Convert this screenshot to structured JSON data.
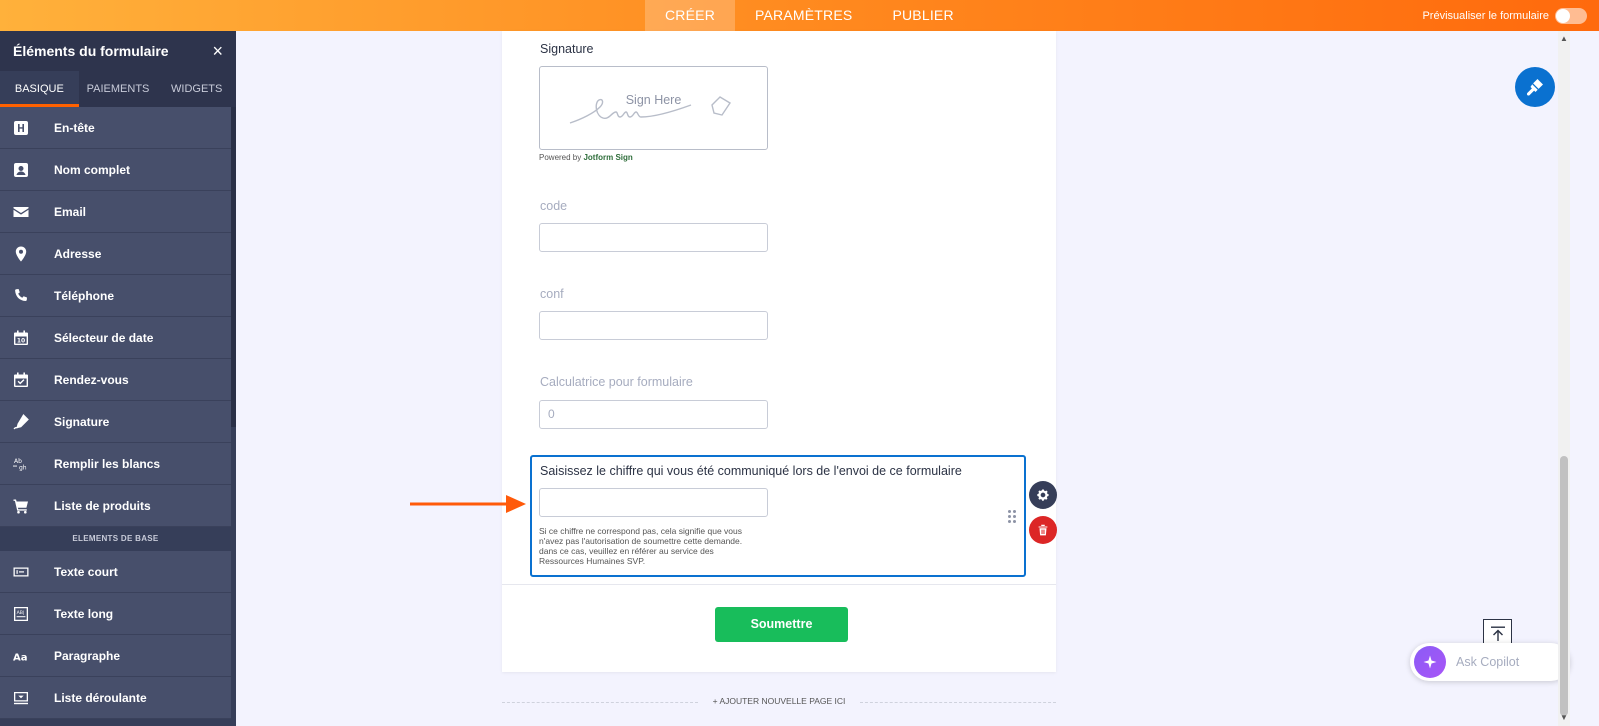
{
  "topbar": {
    "tabs": [
      {
        "label": "CRÉER",
        "active": true
      },
      {
        "label": "PARAMÈTRES",
        "active": false
      },
      {
        "label": "PUBLIER",
        "active": false
      }
    ],
    "preview_label": "Prévisualiser le formulaire"
  },
  "sidebar": {
    "title": "Éléments du formulaire",
    "close": "×",
    "tabs": [
      "BASIQUE",
      "PAIEMENTS",
      "WIDGETS"
    ],
    "items": [
      {
        "label": "En-tête",
        "icon": "heading-icon"
      },
      {
        "label": "Nom complet",
        "icon": "user-card-icon"
      },
      {
        "label": "Email",
        "icon": "envelope-icon"
      },
      {
        "label": "Adresse",
        "icon": "map-pin-icon"
      },
      {
        "label": "Téléphone",
        "icon": "phone-icon"
      },
      {
        "label": "Sélecteur de date",
        "icon": "calendar-icon"
      },
      {
        "label": "Rendez-vous",
        "icon": "calendar-check-icon"
      },
      {
        "label": "Signature",
        "icon": "pen-icon"
      },
      {
        "label": "Remplir les blancs",
        "icon": "fill-blanks-icon"
      },
      {
        "label": "Liste de produits",
        "icon": "cart-icon"
      }
    ],
    "section_label": "ELEMENTS DE BASE",
    "base_items": [
      {
        "label": "Texte court",
        "icon": "short-text-icon"
      },
      {
        "label": "Texte long",
        "icon": "long-text-icon"
      },
      {
        "label": "Paragraphe",
        "icon": "paragraph-icon"
      },
      {
        "label": "Liste déroulante",
        "icon": "dropdown-icon"
      }
    ]
  },
  "form": {
    "signature_label": "Signature",
    "signature_placeholder": "Sign Here",
    "powered_by": "Powered by ",
    "powered_brand": "Jotform Sign",
    "code_label": "code",
    "conf_label": "conf",
    "calc_label": "Calculatrice pour formulaire",
    "calc_value": "0",
    "question_label": "Saisissez le chiffre qui vous été communiqué lors de l'envoi de ce formulaire",
    "help_lines": [
      "Si ce chiffre ne correspond pas, cela signifie que vous",
      "n'avez pas l'autorisation de soumettre cette demande.",
      "dans ce cas, veuillez en référer au service des",
      "Ressources Humaines SVP."
    ],
    "submit_label": "Soumettre",
    "add_page": "+ AJOUTER NOUVELLE PAGE ICI"
  },
  "copilot": {
    "label": "Ask Copilot"
  },
  "colors": {
    "accent": "#ff6100",
    "primary": "#0a71d0",
    "submit": "#18bd5b",
    "delete": "#dc2626"
  }
}
